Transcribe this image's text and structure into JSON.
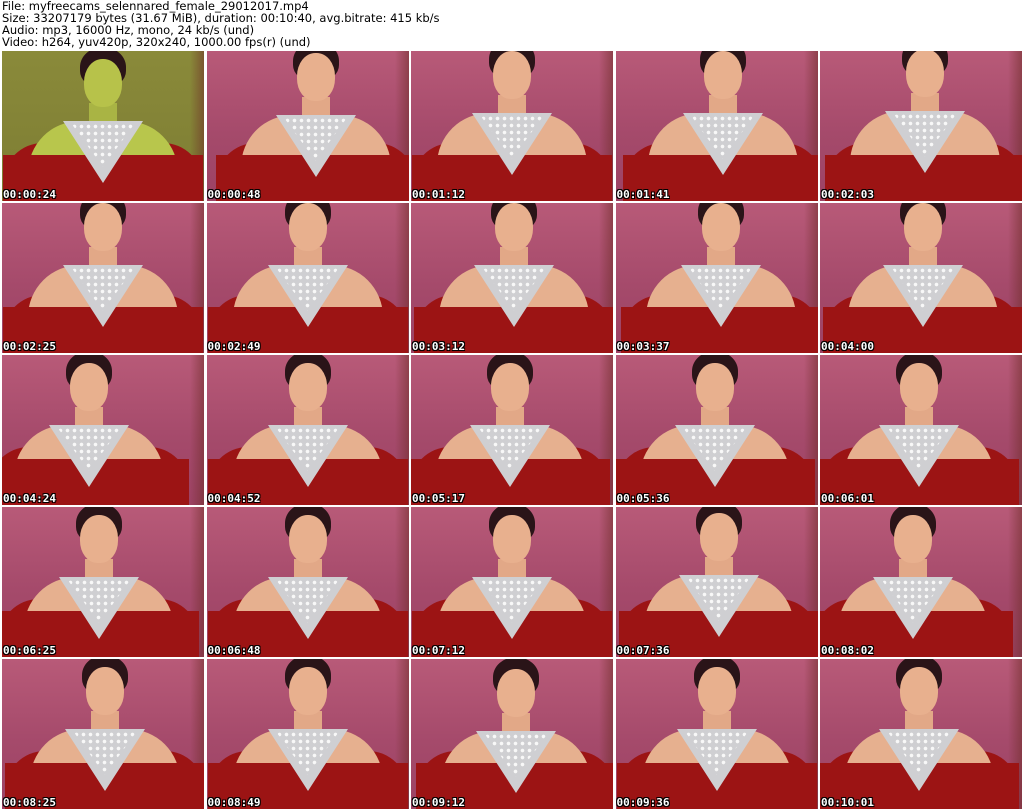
{
  "header": {
    "file_line": "File: myfreecams_selennared_female_29012017.mp4",
    "size_line": "Size: 33207179 bytes (31.67 MiB), duration: 00:10:40, avg.bitrate: 415 kb/s",
    "audio_line": "Audio: mp3, 16000 Hz, mono, 24 kb/s (und)",
    "video_line": "Video: h264, yuv420p, 320x240, 1000.00 fps(r) (und)"
  },
  "thumbnails": [
    {
      "timestamp": "00:00:24"
    },
    {
      "timestamp": "00:00:48"
    },
    {
      "timestamp": "00:01:12"
    },
    {
      "timestamp": "00:01:41"
    },
    {
      "timestamp": "00:02:03"
    },
    {
      "timestamp": "00:02:25"
    },
    {
      "timestamp": "00:02:49"
    },
    {
      "timestamp": "00:03:12"
    },
    {
      "timestamp": "00:03:37"
    },
    {
      "timestamp": "00:04:00"
    },
    {
      "timestamp": "00:04:24"
    },
    {
      "timestamp": "00:04:52"
    },
    {
      "timestamp": "00:05:17"
    },
    {
      "timestamp": "00:05:36"
    },
    {
      "timestamp": "00:06:01"
    },
    {
      "timestamp": "00:06:25"
    },
    {
      "timestamp": "00:06:48"
    },
    {
      "timestamp": "00:07:12"
    },
    {
      "timestamp": "00:07:36"
    },
    {
      "timestamp": "00:08:02"
    },
    {
      "timestamp": "00:08:25"
    },
    {
      "timestamp": "00:08:49"
    },
    {
      "timestamp": "00:09:12"
    },
    {
      "timestamp": "00:09:36"
    },
    {
      "timestamp": "00:10:01"
    }
  ],
  "colors": {
    "wall": "#b85a78",
    "dress": "#9c1414",
    "skin": "#e8b08e",
    "hair": "#2a1418",
    "necklace": "#cfcfd2",
    "timestamp_text": "#ffffff"
  }
}
